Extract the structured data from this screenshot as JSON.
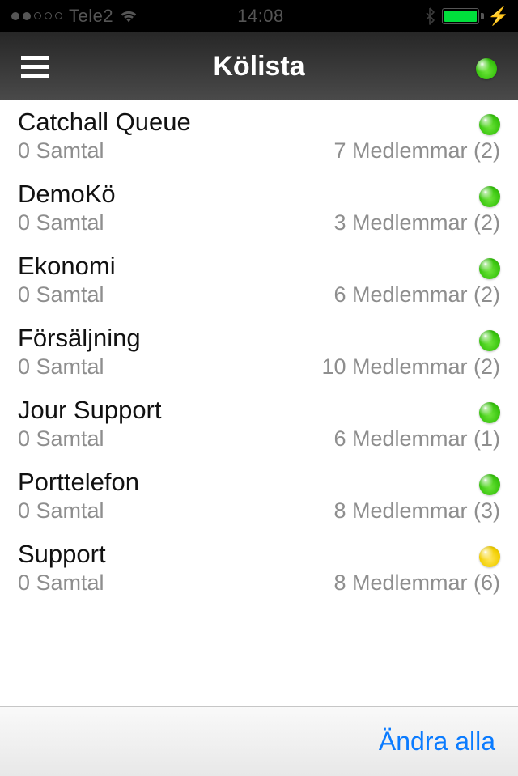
{
  "statusbar": {
    "carrier": "Tele2",
    "time": "14:08",
    "signal_strength": 2,
    "signal_total": 5,
    "battery_pct": 100,
    "battery_charging": true
  },
  "header": {
    "title": "Kölista",
    "status_color": "green"
  },
  "labels": {
    "calls_word": "Samtal",
    "members_word": "Medlemmar"
  },
  "queues": [
    {
      "name": "Catchall Queue",
      "calls": 0,
      "members": 7,
      "active": 2,
      "status": "green"
    },
    {
      "name": "DemoKö",
      "calls": 0,
      "members": 3,
      "active": 2,
      "status": "green"
    },
    {
      "name": "Ekonomi",
      "calls": 0,
      "members": 6,
      "active": 2,
      "status": "green"
    },
    {
      "name": "Försäljning",
      "calls": 0,
      "members": 10,
      "active": 2,
      "status": "green"
    },
    {
      "name": "Jour Support",
      "calls": 0,
      "members": 6,
      "active": 1,
      "status": "green"
    },
    {
      "name": "Porttelefon",
      "calls": 0,
      "members": 8,
      "active": 3,
      "status": "green"
    },
    {
      "name": "Support",
      "calls": 0,
      "members": 8,
      "active": 6,
      "status": "yellow"
    }
  ],
  "footer": {
    "edit_all_label": "Ändra alla"
  }
}
